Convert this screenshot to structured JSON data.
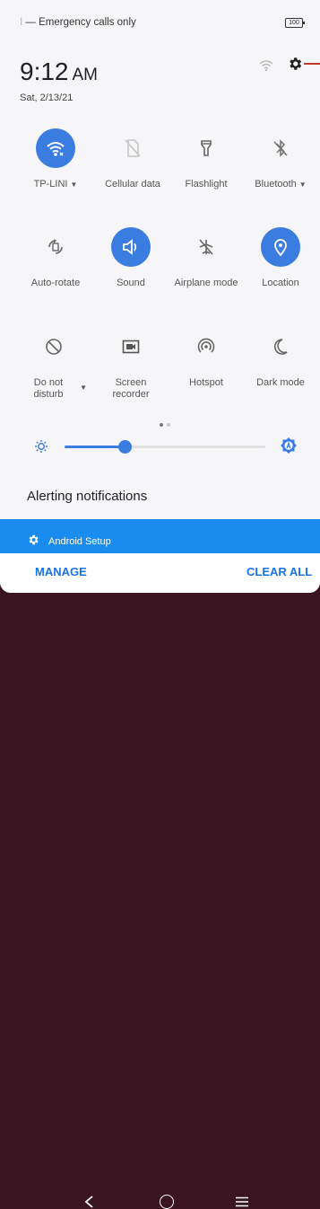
{
  "status_bar": {
    "pre_text": "I",
    "carrier_text": "— Emergency calls only",
    "battery_level": "100"
  },
  "header": {
    "time": "9:12",
    "am_pm": "AM",
    "date": "Sat, 2/13/21",
    "settings_icon": "gear-icon",
    "signal_icon": "wifi-icon"
  },
  "quick_settings": [
    {
      "label": "TP-LINI",
      "icon": "wifi-icon",
      "active": true,
      "has_dropdown": true
    },
    {
      "label": "Cellular data",
      "icon": "no-sim-icon",
      "active": false,
      "has_dropdown": false
    },
    {
      "label": "Flashlight",
      "icon": "flashlight-icon",
      "active": false,
      "has_dropdown": false
    },
    {
      "label": "Bluetooth",
      "icon": "bluetooth-off-icon",
      "active": false,
      "has_dropdown": true
    },
    {
      "label": "Auto-rotate",
      "icon": "rotate-icon",
      "active": false,
      "has_dropdown": false
    },
    {
      "label": "Sound",
      "icon": "volume-icon",
      "active": true,
      "has_dropdown": false
    },
    {
      "label": "Airplane mode",
      "icon": "airplane-icon",
      "active": false,
      "has_dropdown": false
    },
    {
      "label": "Location",
      "icon": "location-icon",
      "active": true,
      "has_dropdown": false
    },
    {
      "label": "Do not disturb",
      "icon": "do-not-disturb-icon",
      "active": false,
      "has_dropdown": true
    },
    {
      "label": "Screen recorder",
      "icon": "screen-recorder-icon",
      "active": false,
      "has_dropdown": false
    },
    {
      "label": "Hotspot",
      "icon": "hotspot-icon",
      "active": false,
      "has_dropdown": false
    },
    {
      "label": "Dark mode",
      "icon": "moon-icon",
      "active": false,
      "has_dropdown": false
    }
  ],
  "pagination": {
    "pages": 2,
    "current": 1
  },
  "brightness": {
    "level_fraction": 0.3,
    "auto_icon": "auto-brightness-icon"
  },
  "notifications": {
    "section_title": "Alerting notifications",
    "items": [
      {
        "app": "Android Setup",
        "icon": "gear-icon"
      }
    ],
    "manage_label": "MANAGE",
    "clear_all_label": "CLEAR ALL"
  },
  "colors": {
    "accent": "#3b7ce0",
    "notification_bar": "#1a8cf0",
    "nav_background": "#3a1420"
  }
}
